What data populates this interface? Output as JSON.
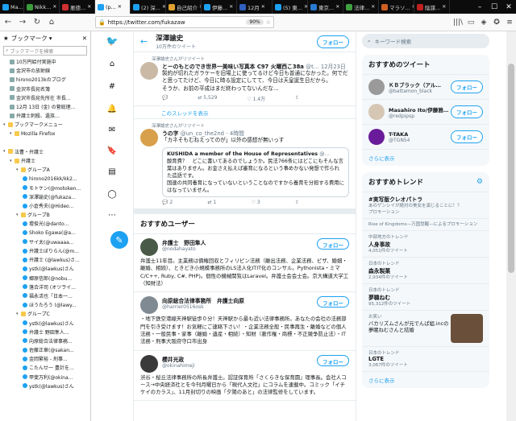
{
  "browser": {
    "tabs": [
      {
        "label": "Ma...",
        "active": false
      },
      {
        "label": "Nikk...",
        "active": false
      },
      {
        "label": "悪徳...",
        "active": false
      },
      {
        "label": "(p...",
        "active": true
      },
      {
        "label": "(2) 深...",
        "active": false
      },
      {
        "label": "自己紹介",
        "active": false
      },
      {
        "label": "伊藤...",
        "active": false
      },
      {
        "label": "12月",
        "active": false
      },
      {
        "label": "(5) 東...",
        "active": false
      },
      {
        "label": "東京...",
        "active": false
      },
      {
        "label": "法律...",
        "active": false
      },
      {
        "label": "マラソ...",
        "active": false
      },
      {
        "label": "陰謀...",
        "active": false
      }
    ],
    "url": "https://twitter.com/fukazaw",
    "zoom": "90%"
  },
  "bookmarks": {
    "title": "ブックマーク",
    "search_placeholder": "ブックマークを検索",
    "items": [
      {
        "label": "10万円給付実施中",
        "depth": 1,
        "kind": "page"
      },
      {
        "label": "金沢市の放射線",
        "depth": 1,
        "kind": "page"
      },
      {
        "label": "hirono2013kのブログ",
        "depth": 1,
        "kind": "page"
      },
      {
        "label": "金沢市長宛名簿",
        "depth": 1,
        "kind": "page"
      },
      {
        "label": "金沢市長宛先所在  市長...",
        "depth": 1,
        "kind": "page"
      },
      {
        "label": "12月 13日 (金) の菅総理...",
        "depth": 1,
        "kind": "page"
      },
      {
        "label": "弁護士刺殺、遺族…",
        "depth": 1,
        "kind": "page"
      },
      {
        "label": "ブックマークメニュー",
        "depth": 0,
        "kind": "folder"
      },
      {
        "label": "Mozilla Firefox",
        "depth": 1,
        "kind": "folder"
      },
      {
        "label": "",
        "depth": 1,
        "kind": "spacer"
      },
      {
        "label": "法曹・弁護士",
        "depth": 0,
        "kind": "folder"
      },
      {
        "label": "弁護士",
        "depth": 1,
        "kind": "folder"
      },
      {
        "label": "グループA",
        "depth": 2,
        "kind": "folder"
      },
      {
        "label": "hirono2016kk/kk2...",
        "depth": 3,
        "kind": "tw"
      },
      {
        "label": "モトケン(@motoken...",
        "depth": 3,
        "kind": "tw"
      },
      {
        "label": "深澤諭史(@fukaza...",
        "depth": 3,
        "kind": "tw"
      },
      {
        "label": "小倉秀夫(@Hideo...",
        "depth": 3,
        "kind": "tw"
      },
      {
        "label": "グループB",
        "depth": 2,
        "kind": "folder"
      },
      {
        "label": "壇俊光(@danto...",
        "depth": 3,
        "kind": "tw"
      },
      {
        "label": "Shoko Egawa(@a...",
        "depth": 3,
        "kind": "tw"
      },
      {
        "label": "サイ太(@uwaaaa...",
        "depth": 3,
        "kind": "tw"
      },
      {
        "label": "弁護士ぼりらん(@m...",
        "depth": 3,
        "kind": "tw"
      },
      {
        "label": "弁護士 (@lawkus)さ...",
        "depth": 3,
        "kind": "tw"
      },
      {
        "label": "ystk(@lawkus)さん",
        "depth": 3,
        "kind": "tw"
      },
      {
        "label": "郷原信郎(@nobu...",
        "depth": 3,
        "kind": "tw"
      },
      {
        "label": "落合洋司 (オツライ...",
        "depth": 3,
        "kind": "tw"
      },
      {
        "label": "福永活也「日本一...",
        "depth": 3,
        "kind": "tw"
      },
      {
        "label": "ほうたろう (@lawy...",
        "depth": 3,
        "kind": "tw"
      },
      {
        "label": "グループC",
        "depth": 2,
        "kind": "folder"
      },
      {
        "label": "ystk(@lawkus)さん",
        "depth": 3,
        "kind": "tw"
      },
      {
        "label": "弁護士  野田隼人...",
        "depth": 3,
        "kind": "tw"
      },
      {
        "label": "向原総合法律事務...",
        "depth": 3,
        "kind": "tw"
      },
      {
        "label": "佐藤正章(@sakan...",
        "depth": 3,
        "kind": "tw"
      },
      {
        "label": "金岡繁裕 - 刑事...",
        "depth": 3,
        "kind": "tw"
      },
      {
        "label": "こたんせ一 豊計を...",
        "depth": 3,
        "kind": "tw"
      },
      {
        "label": "甲斐万利(@okina...",
        "depth": 3,
        "kind": "tw"
      },
      {
        "label": "ystk(@lawkus)さん",
        "depth": 3,
        "kind": "tw"
      }
    ]
  },
  "header": {
    "title": "深澤諭史",
    "subtitle": "10万件のツイート",
    "follow_label": "フォロー",
    "back_icon": "arrow-left-icon"
  },
  "tweets": [
    {
      "retweet_by": "深澤諭史さんがリツイート",
      "name": "とーのもとのでき世界一美味い写真本 C97 火曜西こ38a",
      "handle": "@t…",
      "time": "12月23日",
      "text": "製約が切れたガラケーを旧場上に使ってるけど今日も普通になかった。何でだと思ってたけど、今日に時る設定にしてて、今日は天皇誕生日だから。\nそうか、お前の平成はまだ終わってないんだな…",
      "replies": "",
      "retweets": "5,529",
      "likes": "1.4万",
      "avatar_color": "#c9b9a5"
    }
  ],
  "thread_link": "このスレッドを表示",
  "tweet2": {
    "retweet_by": "深澤諭史さんがリツイート",
    "name": "うの字",
    "handle": "@un_co_the2nd",
    "time": "4時間",
    "text": "「カネそもむねえってのが」以外の感想が無いっす",
    "quote_name": "KUSHIDA a member of the House of Representatives",
    "quote_handle": "@…",
    "quote_text": "酸育費？　どこに書いてあるのでしょうか。民法766条にはどこにもそんな言葉はありません。お金さえ払えば審育になるという事めかない発想で作られた造語です。\n国連の共同養育になっていないということなのですから養育を分担する費用にはなっていません。",
    "replies": "2",
    "retweets": "1",
    "likes": "3",
    "avatar_color": "#d8a04a"
  },
  "suggested": {
    "title": "おすすめユーザー",
    "follow_label": "フォロー",
    "users": [
      {
        "name": "弁護士　野田隼人",
        "handle": "@nodahayato",
        "bio": "弁護士11年目。主業務は債権回収とフィリピン法務（離出法務、企業法務、ビザ、婚姻・離婚、相続）、ときどき小規模事務所のLS法人化ITIT化のコンサル。Pythonista・ミマC/C++, Ruby, C#, PHP)。個性の機械関覧はLaravel。弁護士会会士会。京大構道大学工（知財法）",
        "avatar_color": "#4a5a48"
      },
      {
        "name": "向原総合法律事務所　弁護士向原",
        "handle": "@harrier0516osk",
        "bio": "・地下鉄空港線天神駅徒歩０分！天神駅から最も近い法律事務所。あなたの会社の法務部門を引き受けます！お気軽にご連絡下さい！・企業法務全般・民事再生・離婚などの個人法務・一般民事・家事（離婚・遺産・相続）・知財（著作権・商標・不正競争防止法）・IT法務・刑事大阪府守口市出身",
        "avatar_color": "#7f8a93"
      },
      {
        "name": "櫻井光政",
        "handle": "@okinahimeji",
        "bio": "渋谷・桜丘法律事務所の所長弁護士。認証保育所「さくらきな保育園」理事長。会社人コース→中央経済社とを今刊月曜日から「現代人文社」にコラムを連載中。コミック「イチケイのカラス」、11月封切りの映画「夕陽のあと」の法律監修をしています。",
        "avatar_color": "#3a3a3a"
      }
    ]
  },
  "right": {
    "search_placeholder": "キーワード検索",
    "recommend_title": "おすすめのツイート",
    "follow_label": "フォロー",
    "recommended": [
      {
        "name": "ＫＢブラック（アル…",
        "handle": "@battamon_black",
        "avatar_color": "#9a9a9a"
      },
      {
        "name": "Masahiro Ito/伊藤雅…",
        "handle": "@redpipsp",
        "avatar_color": "#d6c6b4"
      },
      {
        "name": "T-TAKA",
        "handle": "@TGN54",
        "avatar_color": "#6a1b9a"
      }
    ],
    "more": "さらに表示",
    "trends_title": "おすすめトレンド",
    "trends": [
      {
        "context": "",
        "name": "#実写版クレオパトラ",
        "promo": "あのゲンシイが絶対の美女を演じることに！？\nプロモーション"
      },
      {
        "context": "",
        "name": "",
        "promo": "Rise of Kingdoms—万国覚醒—によるプロモーション"
      },
      {
        "context": "中部地方のトレンド",
        "name": "人身事故",
        "promo": "4,051件のツイート"
      },
      {
        "context": "日本のトレンド",
        "name": "森永製菓",
        "promo": "2,934件のツイート"
      },
      {
        "context": "日本のトレンド",
        "name": "夢職ねむ",
        "promo": "95,312件のツイート"
      }
    ],
    "trend_card": {
      "context": "お笑い",
      "text": "バカリズムさんが元でんぱ組.incの夢眠ねむさんと結婚"
    },
    "trends2": [
      {
        "context": "日本のトレンド",
        "name": "LGTE",
        "promo": "3,067件のツイート"
      }
    ],
    "more2": "さらに表示"
  }
}
